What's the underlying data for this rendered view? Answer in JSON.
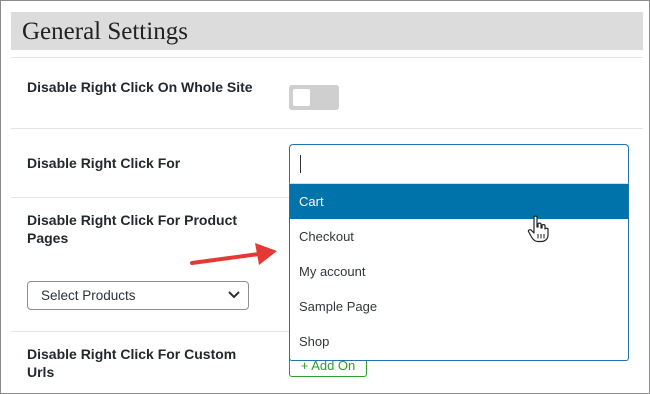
{
  "header": {
    "title": "General Settings"
  },
  "settings": {
    "whole_site_label": "Disable Right Click On Whole Site",
    "whole_site_toggle": {
      "on": false
    },
    "right_click_for_label": "Disable Right Click For",
    "right_click_for_input": {
      "value": ""
    },
    "product_pages_label": "Disable Right Click For Product Pages",
    "products_select_value": "Select Products",
    "custom_urls_label": "Disable Right Click For Custom Urls",
    "add_on_label": "+ Add On"
  },
  "dropdown": {
    "options": [
      "Cart",
      "Checkout",
      "My account",
      "Sample Page",
      "Shop"
    ],
    "highlighted": "Cart"
  },
  "colors": {
    "header_bg": "#dcdcdc",
    "highlight": "#0073aa",
    "focus_border": "#2271b1",
    "annotation_arrow": "#e53935",
    "add_on_green": "#2f9e2f"
  },
  "icons": [
    "chevron-down-icon",
    "red-arrow-icon",
    "hand-pointer-icon"
  ]
}
